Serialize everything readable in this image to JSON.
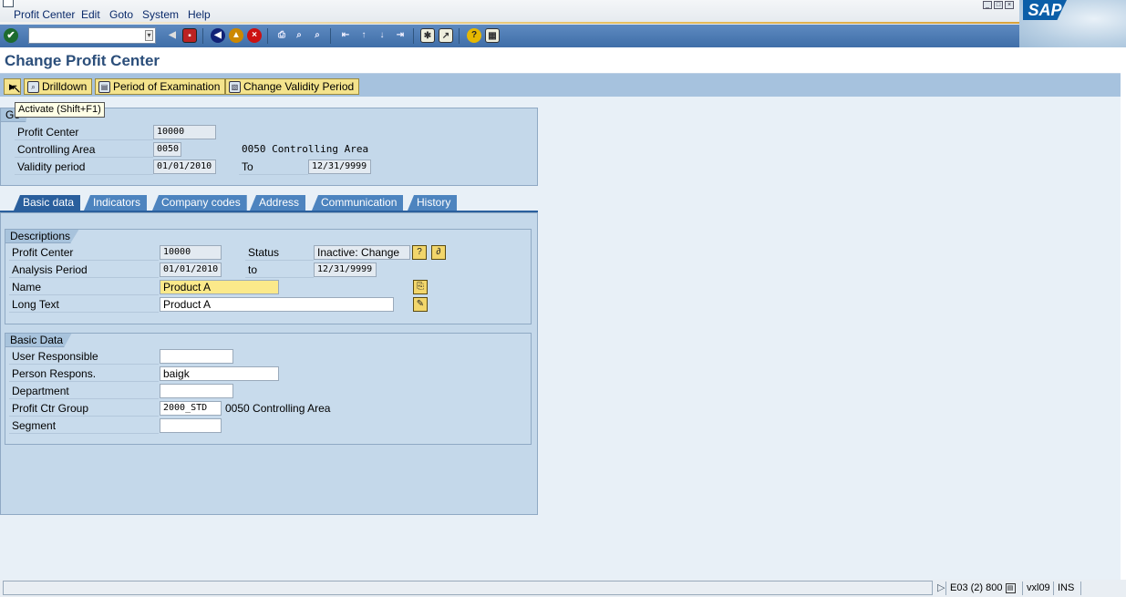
{
  "menu": [
    "Profit Center",
    "Edit",
    "Goto",
    "System",
    "Help"
  ],
  "brand": "SAP",
  "toolbar": {
    "command_value": ""
  },
  "title": "Change Profit Center",
  "app_toolbar": {
    "drilldown": "Drilldown",
    "period_exam": "Period of Examination",
    "change_validity": "Change Validity Period"
  },
  "tooltip": "Activate  (Shift+F1)",
  "header": {
    "group_title": "Ge",
    "profit_center_label": "Profit Center",
    "profit_center": "10000",
    "controlling_area_label": "Controlling Area",
    "controlling_area": "0050",
    "controlling_area_text": "0050 Controlling Area",
    "validity_label": "Validity period",
    "valid_from": "01/01/2010",
    "to_label": "To",
    "valid_to": "12/31/9999"
  },
  "tabs": [
    "Basic data",
    "Indicators",
    "Company codes",
    "Address",
    "Communication",
    "History"
  ],
  "descriptions": {
    "title": "Descriptions",
    "profit_center_label": "Profit Center",
    "profit_center": "10000",
    "status_label": "Status",
    "status": "Inactive: Change",
    "analysis_label": "Analysis Period",
    "analysis_from": "01/01/2010",
    "to_label": "to",
    "analysis_to": "12/31/9999",
    "name_label": "Name",
    "name": "Product A",
    "longtext_label": "Long Text",
    "longtext": "Product A"
  },
  "basic": {
    "title": "Basic Data",
    "user_resp_label": "User Responsible",
    "user_resp": "",
    "person_resp_label": "Person Respons.",
    "person_resp": "baigk",
    "department_label": "Department",
    "department": "",
    "group_label": "Profit Ctr Group",
    "group": "2000_STD",
    "group_text": "0050 Controlling Area",
    "segment_label": "Segment",
    "segment": ""
  },
  "status_bar": {
    "system": "E03 (2) 800",
    "server": "vxl09",
    "mode": "INS"
  }
}
